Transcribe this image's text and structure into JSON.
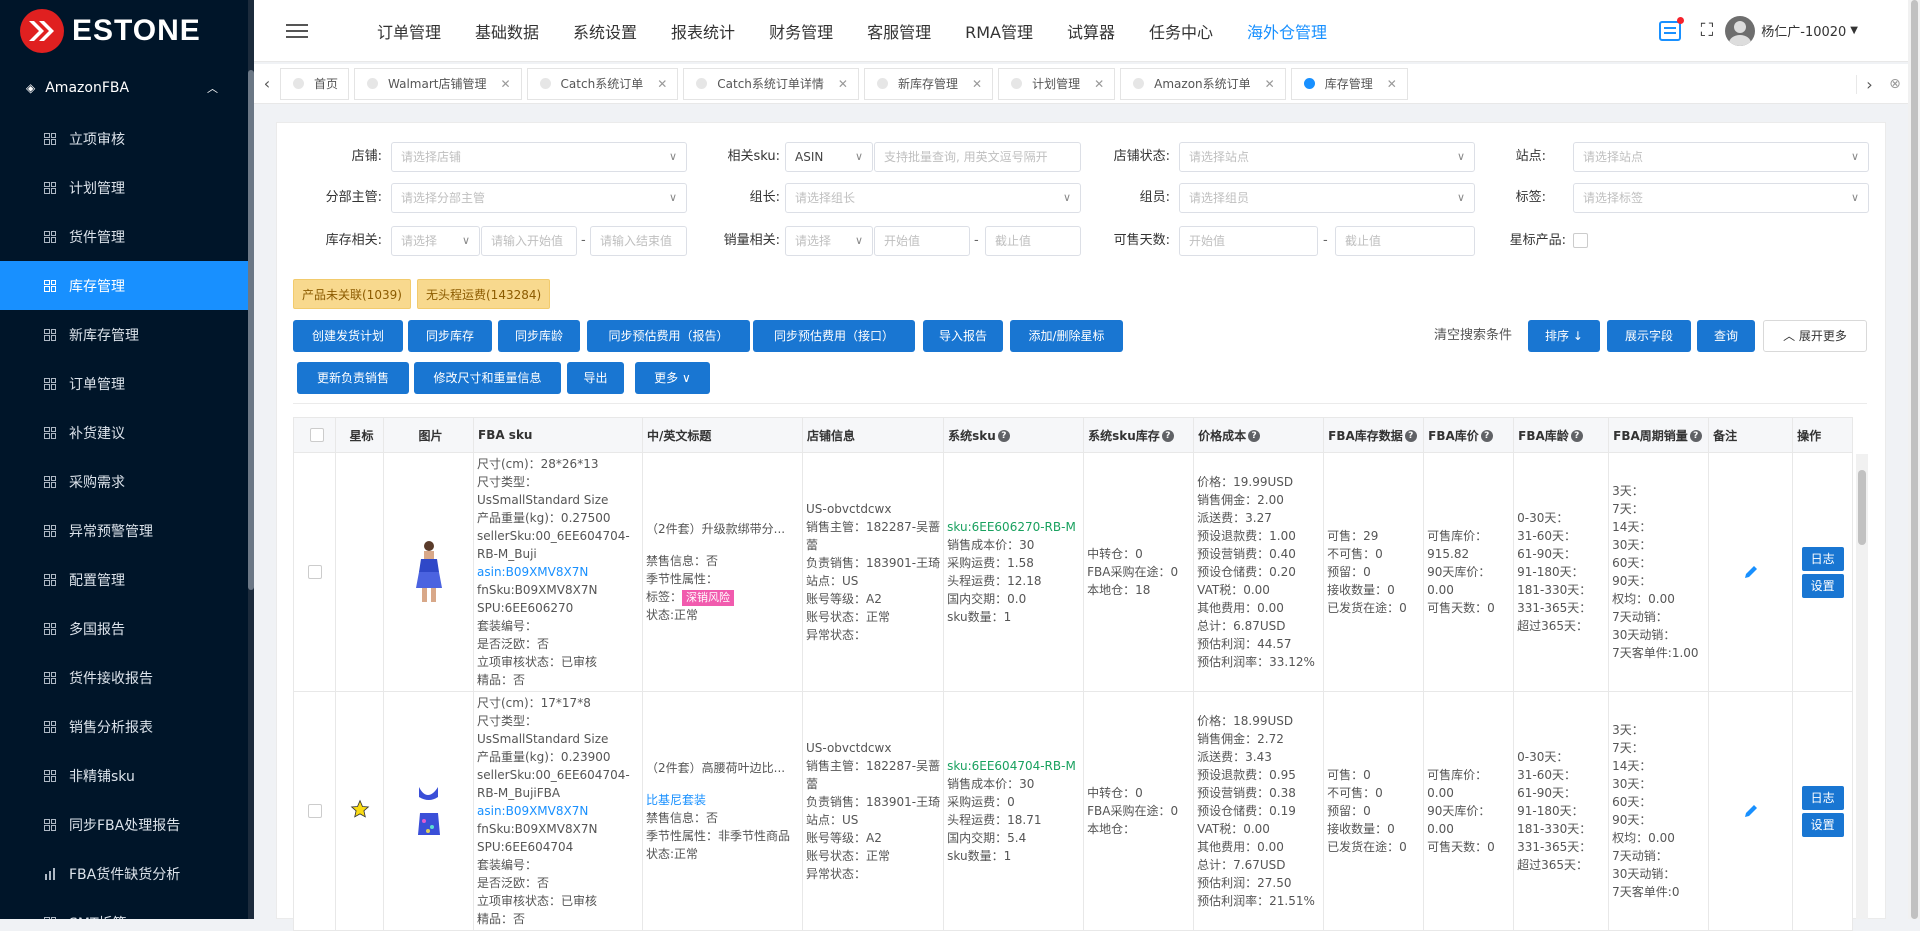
{
  "brand": {
    "name": "ESTONE",
    "accent": "#1890ff",
    "sidebar_bg": "#001529"
  },
  "sidebar": {
    "group": "AmazonFBA",
    "items": [
      {
        "label": "立项审核",
        "icon": "grid-icon"
      },
      {
        "label": "计划管理",
        "icon": "grid-icon"
      },
      {
        "label": "货件管理",
        "icon": "grid-icon"
      },
      {
        "label": "库存管理",
        "icon": "grid-icon",
        "active": true
      },
      {
        "label": "新库存管理",
        "icon": "grid-icon"
      },
      {
        "label": "订单管理",
        "icon": "grid-icon"
      },
      {
        "label": "补货建议",
        "icon": "grid-icon"
      },
      {
        "label": "采购需求",
        "icon": "grid-icon"
      },
      {
        "label": "异常预警管理",
        "icon": "grid-icon"
      },
      {
        "label": "配置管理",
        "icon": "grid-icon"
      },
      {
        "label": "多国报告",
        "icon": "grid-icon"
      },
      {
        "label": "货件接收报告",
        "icon": "grid-icon"
      },
      {
        "label": "销售分析报表",
        "icon": "grid-icon"
      },
      {
        "label": "非精铺sku",
        "icon": "grid-icon"
      },
      {
        "label": "同步FBA处理报告",
        "icon": "grid-icon"
      },
      {
        "label": "FBA货件缺货分析",
        "icon": "bar-chart-icon"
      },
      {
        "label": "SMT拆箱",
        "icon": "grid-icon"
      }
    ]
  },
  "topnav": [
    "订单管理",
    "基础数据",
    "系统设置",
    "报表统计",
    "财务管理",
    "客服管理",
    "RMA管理",
    "试算器",
    "任务中心",
    "海外仓管理"
  ],
  "topnav_active": "海外仓管理",
  "user": {
    "name": "杨仁广-10020"
  },
  "tabs": [
    {
      "label": "首页",
      "closable": false
    },
    {
      "label": "Walmart店铺管理",
      "closable": true
    },
    {
      "label": "Catch系统订单",
      "closable": true
    },
    {
      "label": "Catch系统订单详情",
      "closable": true
    },
    {
      "label": "新库存管理",
      "closable": true
    },
    {
      "label": "计划管理",
      "closable": true
    },
    {
      "label": "Amazon系统订单",
      "closable": true
    },
    {
      "label": "库存管理",
      "closable": true,
      "active": true
    }
  ],
  "filters": {
    "shop": {
      "label": "店铺:",
      "placeholder": "请选择店铺"
    },
    "related_sku": {
      "label": "相关sku:",
      "type_value": "ASIN",
      "placeholder": "支持批量查询, 用英文逗号隔开"
    },
    "shop_status": {
      "label": "店铺状态:",
      "placeholder": "请选择站点"
    },
    "site": {
      "label": "站点:",
      "placeholder": "请选择站点"
    },
    "dept_manager": {
      "label": "分部主管:",
      "placeholder": "请选择分部主管"
    },
    "team_leader": {
      "label": "组长:",
      "placeholder": "请选择组长"
    },
    "member": {
      "label": "组员:",
      "placeholder": "请选择组员"
    },
    "tag": {
      "label": "标签:",
      "placeholder": "请选择标签"
    },
    "stock": {
      "label": "库存相关:",
      "select": "请选择",
      "start": "请输入开始值",
      "end": "请输入结束值"
    },
    "sales": {
      "label": "销量相关:",
      "select": "请选择",
      "start": "开始值",
      "end": "截止值"
    },
    "sellable_days": {
      "label": "可售天数:",
      "start": "开始值",
      "end": "截止值"
    },
    "star": {
      "label": "星标产品:"
    }
  },
  "alerts": {
    "unlinked": "产品未关联(1039)",
    "no_freight": "无头程运费(143284)"
  },
  "actions": {
    "create_plan": "创建发货计划",
    "sync_stock": "同步库存",
    "sync_age": "同步库龄",
    "sync_fee_report": "同步预估费用（报告）",
    "sync_fee_api": "同步预估费用（接口）",
    "import_report": "导入报告",
    "star_toggle": "添加/删除星标",
    "update_sales": "更新负责销售",
    "edit_size": "修改尺寸和重量信息",
    "export": "导出",
    "more": "更多",
    "clear": "清空搜索条件",
    "sort": "排序",
    "fields": "展示字段",
    "query": "查询",
    "expand": "展开更多"
  },
  "table": {
    "headers": [
      "",
      "星标",
      "图片",
      "FBA sku",
      "中/英文标题",
      "店铺信息",
      "系统sku",
      "系统sku库存",
      "价格成本",
      "FBA库存数据",
      "FBA库价",
      "FBA库龄",
      "FBA周期销量",
      "备注",
      "操作"
    ],
    "help_cols": [
      6,
      7,
      8,
      9,
      10,
      11,
      12
    ],
    "rows": [
      {
        "starred": false,
        "fba": [
          "尺寸(cm)：28*26*13",
          "尺寸类型：UsSmallStandard Size",
          "产品重量(kg)：0.27500",
          "sellerSku:00_6EE604704-RB-M_Buji",
          "asin:B09XMV8X7N",
          "fnSku:B09XMV8X7N",
          "SPU:6EE606270",
          "套装编号：",
          "是否泛欧：否",
          "立项审核状态：已审核",
          "精品：否"
        ],
        "title": "（2件套）升级款绑带分...",
        "title_link": "",
        "title_info": [
          "禁售信息：否",
          "季节性属性：",
          "标签：",
          "状态:正常"
        ],
        "title_tag": "深销风险",
        "shop": [
          "US-obvctdcwx",
          "销售主管：182287-吴蔷蕾",
          "负责销售：183901-王琦",
          "站点：US",
          "账号等级：A2",
          "账号状态：正常",
          "异常状态："
        ],
        "sys_sku": "sku:6EE606270-RB-M",
        "sys_info": [
          "销售成本价：30",
          "采购运费：1.58",
          "头程运费：12.18",
          "国内交期：0.0",
          "sku数量：1"
        ],
        "sku_stock": [
          "中转仓：0",
          "FBA采购在途：0",
          "本地仓：18"
        ],
        "price": [
          "价格：19.99USD",
          "销售佣金：2.00",
          "派送费：3.27",
          "预设退款费：1.00",
          "预设营销费：0.40",
          "预设仓储费：0.20",
          "VAT税：0.00",
          "其他费用：0.00",
          "总计：6.87USD",
          "预估利润：44.57",
          "预估利润率：33.12%"
        ],
        "fba_stock": [
          "可售：29",
          "不可售：0",
          "预留：0",
          "接收数量：0",
          "已发货在途：0"
        ],
        "fba_price": [
          "可售库价：915.82",
          "90天库价：0.00",
          "可售天数：0"
        ],
        "fba_age": [
          "0-30天：",
          "31-60天：",
          "61-90天：",
          "91-180天：",
          "181-330天：",
          "331-365天：",
          "超过365天："
        ],
        "fba_sales": [
          "3天：",
          "7天：",
          "14天：",
          "30天：",
          "60天：",
          "90天：",
          "权均：0.00",
          "7天动销：",
          "30天动销：",
          "7天客单件:1.00"
        ],
        "ops": [
          "日志",
          "设置"
        ]
      },
      {
        "starred": true,
        "fba": [
          "尺寸(cm)：17*17*8",
          "尺寸类型：UsSmallStandard Size",
          "产品重量(kg)：0.23900",
          "sellerSku:00_6EE604704-RB-M_BujiFBA",
          "asin:B09XMV8X7N",
          "fnSku:B09XMV8X7N",
          "SPU:6EE604704",
          "套装编号：",
          "是否泛欧：否",
          "立项审核状态：已审核",
          "精品：否"
        ],
        "title": "（2件套）高腰荷叶边比...",
        "title_link": "比基尼套装",
        "title_info": [
          "禁售信息：否",
          "季节性属性：非季节性商品",
          "状态:正常"
        ],
        "title_tag": "",
        "shop": [
          "US-obvctdcwx",
          "销售主管：182287-吴蔷蕾",
          "负责销售：183901-王琦",
          "站点：US",
          "账号等级：A2",
          "账号状态：正常",
          "异常状态："
        ],
        "sys_sku": "sku:6EE604704-RB-M",
        "sys_info": [
          "销售成本价：30",
          "采购运费：0",
          "头程运费：18.71",
          "国内交期：5.4",
          "sku数量：1"
        ],
        "sku_stock": [
          "中转仓：0",
          "FBA采购在途：0",
          "本地仓："
        ],
        "price": [
          "价格：18.99USD",
          "销售佣金：2.72",
          "派送费：3.43",
          "预设退款费：0.95",
          "预设营销费：0.38",
          "预设仓储费：0.19",
          "VAT税：0.00",
          "其他费用：0.00",
          "总计：7.67USD",
          "预估利润：27.50",
          "预估利润率：21.51%"
        ],
        "fba_stock": [
          "可售：0",
          "不可售：0",
          "预留：0",
          "接收数量：0",
          "已发货在途：0"
        ],
        "fba_price": [
          "可售库价：0.00",
          "90天库价：0.00",
          "可售天数：0"
        ],
        "fba_age": [
          "0-30天：",
          "31-60天：",
          "61-90天：",
          "91-180天：",
          "181-330天：",
          "331-365天：",
          "超过365天："
        ],
        "fba_sales": [
          "3天：",
          "7天：",
          "14天：",
          "30天：",
          "60天：",
          "90天：",
          "权均：0.00",
          "7天动销：",
          "30天动销：",
          "7天客单件:0"
        ],
        "ops": [
          "日志",
          "设置"
        ]
      }
    ]
  }
}
